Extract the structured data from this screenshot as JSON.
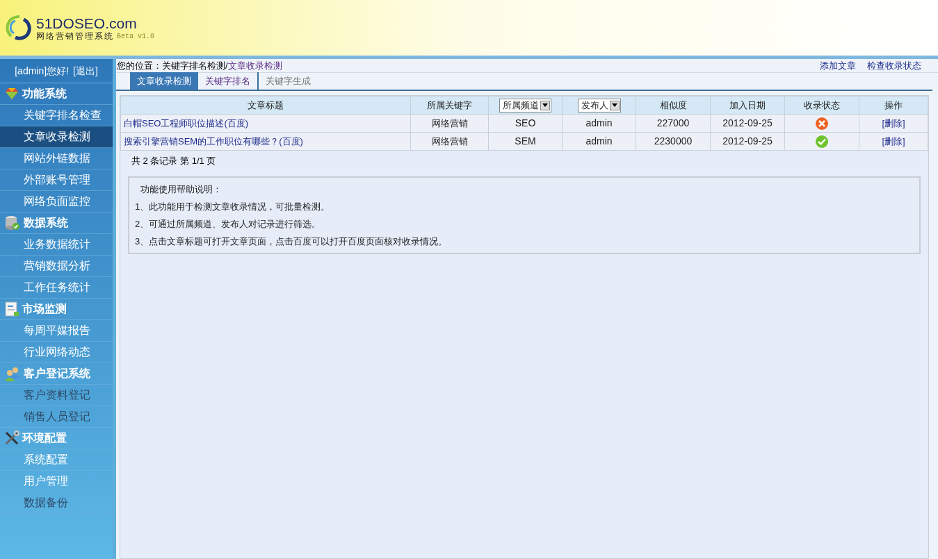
{
  "header": {
    "logo_title": "51DOSEO.com",
    "logo_subtitle": "网络营销管理系统",
    "version": "Beta v1.0"
  },
  "sidebar": {
    "greeting": "[admin]您好!",
    "logout": "[退出]",
    "sections": [
      {
        "title": "功能系统",
        "items": [
          {
            "label": "关键字排名检查",
            "selected": false,
            "disabled": false
          },
          {
            "label": "文章收录检测",
            "selected": true,
            "disabled": false
          },
          {
            "label": "网站外链数据",
            "selected": false,
            "disabled": false
          },
          {
            "label": "外部账号管理",
            "selected": false,
            "disabled": false
          },
          {
            "label": "网络负面监控",
            "selected": false,
            "disabled": false
          }
        ]
      },
      {
        "title": "数据系统",
        "items": [
          {
            "label": "业务数据统计",
            "selected": false,
            "disabled": false
          },
          {
            "label": "营销数据分析",
            "selected": false,
            "disabled": false
          },
          {
            "label": "工作任务统计",
            "selected": false,
            "disabled": false
          }
        ]
      },
      {
        "title": "市场监测",
        "items": [
          {
            "label": "每周平媒报告",
            "selected": false,
            "disabled": false
          },
          {
            "label": "行业网络动态",
            "selected": false,
            "disabled": false
          }
        ]
      },
      {
        "title": "客户登记系统",
        "items": [
          {
            "label": "客户资料登记",
            "selected": false,
            "disabled": true
          },
          {
            "label": "销售人员登记",
            "selected": false,
            "disabled": true
          }
        ]
      },
      {
        "title": "环境配置",
        "items": [
          {
            "label": "系统配置",
            "selected": false,
            "disabled": false
          },
          {
            "label": "用户管理",
            "selected": false,
            "disabled": false
          },
          {
            "label": "数据备份",
            "selected": false,
            "disabled": true
          }
        ]
      }
    ]
  },
  "breadcrumb": {
    "label": "您的位置：",
    "trail": "关键字排名检测/",
    "current": "文章收录检测"
  },
  "actions": [
    "添加文章",
    "检查收录状态"
  ],
  "tabs": [
    {
      "label": "文章收录检测",
      "selected": true,
      "disabled": false
    },
    {
      "label": "关键字排名",
      "selected": false,
      "disabled": false
    },
    {
      "label": "关键字生成",
      "selected": false,
      "disabled": true
    }
  ],
  "table": {
    "columns": [
      {
        "kind": "text",
        "label": "文章标题"
      },
      {
        "kind": "text",
        "label": "所属关键字"
      },
      {
        "kind": "select",
        "label": "所属频道"
      },
      {
        "kind": "select",
        "label": "发布人"
      },
      {
        "kind": "text",
        "label": "相似度"
      },
      {
        "kind": "text",
        "label": "加入日期"
      },
      {
        "kind": "text",
        "label": "收录状态"
      },
      {
        "kind": "text",
        "label": "操作"
      }
    ],
    "rows": [
      {
        "title": "白帽SEO工程师职位描述(百度)",
        "keyword": "网络营销",
        "channel": "SEO",
        "author": "admin",
        "similarity": "227000",
        "date": "2012-09-25",
        "indexed": false,
        "action": "[删除]"
      },
      {
        "title": "搜索引擎营销SEM的工作职位有哪些？(百度)",
        "keyword": "网络营销",
        "channel": "SEM",
        "author": "admin",
        "similarity": "2230000",
        "date": "2012-09-25",
        "indexed": true,
        "action": "[删除]"
      }
    ]
  },
  "pagination": "共 2 条记录 第 1/1 页",
  "help": {
    "title": "功能使用帮助说明：",
    "lines": [
      "1、此功能用于检测文章收录情况，可批量检测。",
      "2、可通过所属频道、发布人对记录进行筛选。",
      "3、点击文章标题可打开文章页面，点击百度可以打开百度页面核对收录情况。"
    ]
  }
}
